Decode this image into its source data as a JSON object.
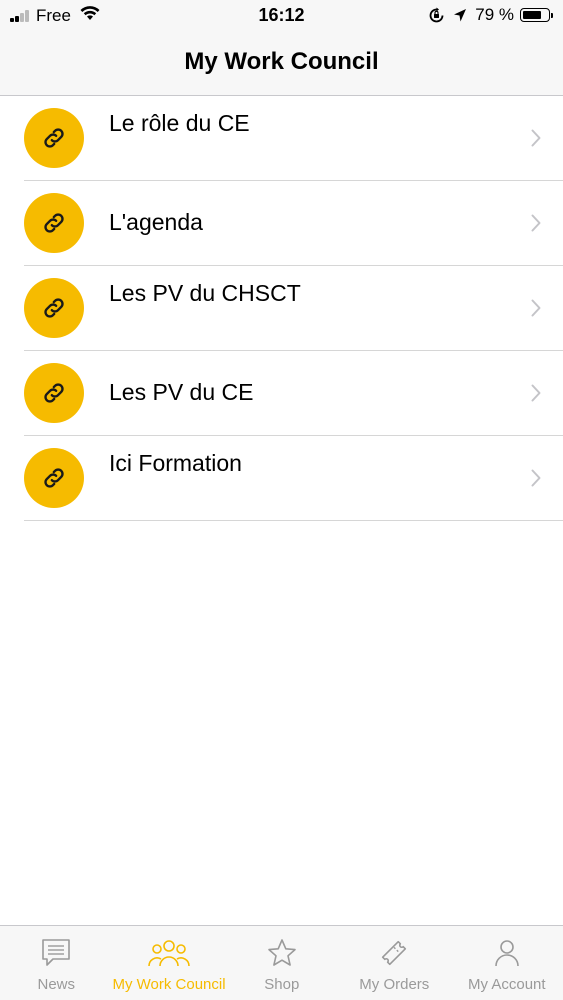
{
  "status_bar": {
    "carrier": "Free",
    "time": "16:12",
    "battery_text": "79 %",
    "battery_level": 0.79
  },
  "nav": {
    "title": "My Work Council"
  },
  "list": {
    "items": [
      {
        "label": "Le rôle du CE",
        "icon": "link-icon"
      },
      {
        "label": "L'agenda",
        "icon": "link-icon"
      },
      {
        "label": "Les PV du CHSCT",
        "icon": "link-icon"
      },
      {
        "label": "Les PV du CE",
        "icon": "link-icon"
      },
      {
        "label": "Ici Formation",
        "icon": "link-icon"
      }
    ]
  },
  "tabs": [
    {
      "label": "News",
      "icon": "chat-icon",
      "active": false
    },
    {
      "label": "My Work Council",
      "icon": "group-icon",
      "active": true
    },
    {
      "label": "Shop",
      "icon": "star-icon",
      "active": false
    },
    {
      "label": "My Orders",
      "icon": "ticket-icon",
      "active": false
    },
    {
      "label": "My Account",
      "icon": "person-icon",
      "active": false
    }
  ],
  "colors": {
    "accent": "#f6bb00",
    "inactive_tab": "#9a9a9a",
    "separator": "#d6d6d6",
    "bar_background": "#f7f7f7"
  }
}
